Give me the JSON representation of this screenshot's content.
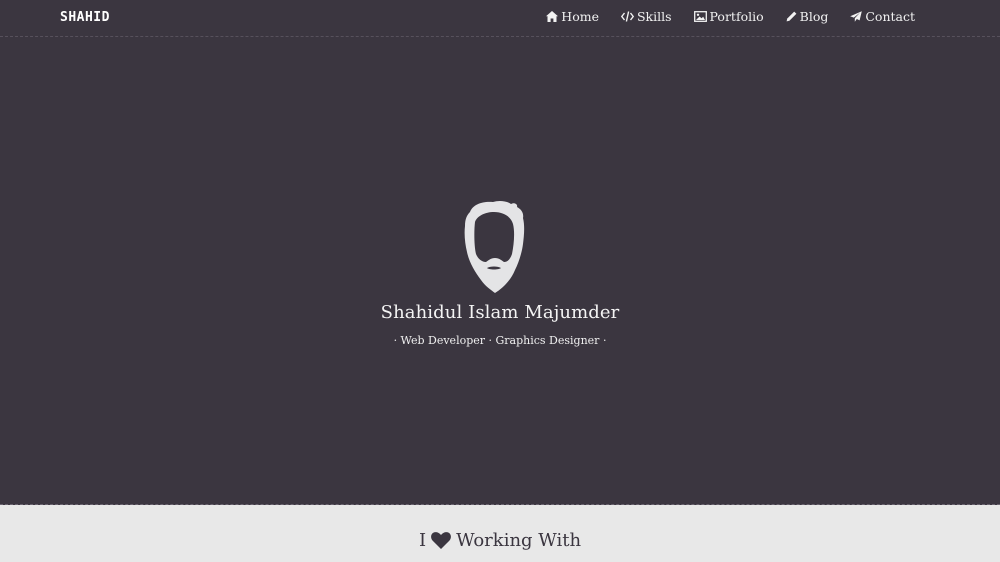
{
  "brand": "SHAHID",
  "nav": {
    "items": [
      {
        "label": "Home",
        "icon": "home-icon"
      },
      {
        "label": "Skills",
        "icon": "code-icon"
      },
      {
        "label": "Portfolio",
        "icon": "image-icon"
      },
      {
        "label": "Blog",
        "icon": "pencil-icon"
      },
      {
        "label": "Contact",
        "icon": "paper-plane-icon"
      }
    ]
  },
  "hero": {
    "avatar_icon": "bearded-face-icon",
    "name": "Shahidul Islam Majumder",
    "tagline": "· Web Developer · Graphics Designer ·"
  },
  "section": {
    "prefix": "I",
    "icon": "heart-icon",
    "suffix": "Working With"
  },
  "colors": {
    "hero_bg": "#3b3640",
    "section_bg": "#e8e8e8",
    "text_light": "#f4f4f4",
    "text_dark": "#3b3640"
  }
}
